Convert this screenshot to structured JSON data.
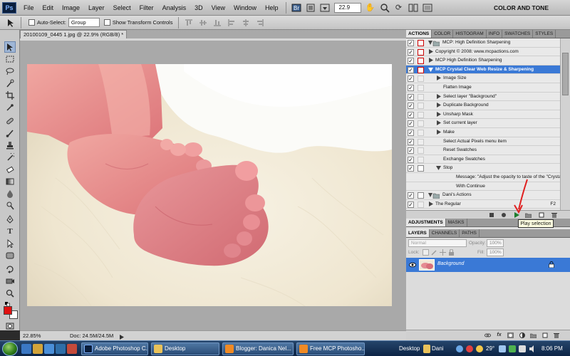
{
  "menubar": {
    "logo": "Ps",
    "items": [
      "File",
      "Edit",
      "Image",
      "Layer",
      "Select",
      "Filter",
      "Analysis",
      "3D",
      "View",
      "Window",
      "Help"
    ],
    "zoom": "22.9",
    "workspace": "COLOR AND TONE"
  },
  "options": {
    "auto_select_label": "Auto-Select:",
    "auto_select_value": "Group",
    "transform_label": "Show Transform Controls"
  },
  "document": {
    "tab_title": "20100109_0445 1.jpg @ 22.9% (RGB/8) *",
    "status_zoom": "22.85%",
    "status_doc": "Doc: 24.5M/24.5M"
  },
  "actions_panel": {
    "tabs": [
      "ACTIONS",
      "COLOR",
      "HISTOGRAM",
      "INFO",
      "SWATCHES",
      "STYLES"
    ],
    "rows": [
      {
        "label": "MCP: High Definition Sharpening",
        "type": "set",
        "checked": true,
        "dialog": "red",
        "indent": 1
      },
      {
        "label": "Copyright © 2008: www.mcpactions.com",
        "type": "action",
        "checked": true,
        "dialog": "red",
        "indent": 1
      },
      {
        "label": "MCP High Definition Sharpening",
        "type": "action",
        "checked": true,
        "dialog": "red",
        "indent": 1
      },
      {
        "label": "MCP Crystal Clear Web Resize & Sharpening",
        "type": "action-open",
        "checked": true,
        "dialog": "red",
        "indent": 1,
        "selected": true
      },
      {
        "label": "Image Size",
        "type": "step",
        "checked": true,
        "dialog": "",
        "indent": 2
      },
      {
        "label": "Flatten Image",
        "type": "step-plain",
        "checked": true,
        "dialog": "",
        "indent": 2
      },
      {
        "label": "Select layer \"Background\"",
        "type": "step",
        "checked": true,
        "dialog": "",
        "indent": 2
      },
      {
        "label": "Duplicate Background",
        "type": "step",
        "checked": true,
        "dialog": "",
        "indent": 2
      },
      {
        "label": "Unsharp Mask",
        "type": "step",
        "checked": true,
        "dialog": "",
        "indent": 2
      },
      {
        "label": "Set current layer",
        "type": "step",
        "checked": true,
        "dialog": "",
        "indent": 2
      },
      {
        "label": "Make",
        "type": "step",
        "checked": true,
        "dialog": "",
        "indent": 2
      },
      {
        "label": "Select Actual Pixels menu item",
        "type": "step-plain",
        "checked": true,
        "dialog": "",
        "indent": 2
      },
      {
        "label": "Reset Swatches",
        "type": "step-plain",
        "checked": true,
        "dialog": "",
        "indent": 2
      },
      {
        "label": "Exchange Swatches",
        "type": "step-plain",
        "checked": true,
        "dialog": "",
        "indent": 2
      },
      {
        "label": "Stop",
        "type": "step-open",
        "checked": true,
        "dialog": "box",
        "indent": 2
      },
      {
        "label": "Message: \"Adjust the opacity to taste of the \"Crystal...",
        "type": "detail",
        "checked": false,
        "dialog": "",
        "indent": 3
      },
      {
        "label": "With Continue",
        "type": "detail",
        "checked": false,
        "dialog": "",
        "indent": 3
      },
      {
        "label": "Dani's Actions",
        "type": "set",
        "checked": true,
        "dialog": "box",
        "indent": 1
      },
      {
        "label": "The Regular",
        "type": "action",
        "checked": true,
        "dialog": "",
        "indent": 1,
        "shortcut": "F2"
      }
    ],
    "tooltip": "Play selection"
  },
  "adjustments_panel": {
    "tabs": [
      "ADJUSTMENTS",
      "MASKS"
    ]
  },
  "layers_panel": {
    "tabs": [
      "LAYERS",
      "CHANNELS",
      "PATHS"
    ],
    "blend_mode": "Normal",
    "opacity_label": "Opacity:",
    "opacity_value": "100%",
    "lock_label": "Lock:",
    "fill_label": "Fill:",
    "fill_value": "100%",
    "layer_name": "Background"
  },
  "taskbar": {
    "buttons": [
      "Adobe Photoshop C...",
      "Desktop",
      "Blogger: Danica Nel...",
      "Free MCP Photosho..."
    ],
    "tray_desktop": "Desktop",
    "tray_user": "Dani",
    "temperature": "29°",
    "clock": "8:06 PM"
  },
  "colors": {
    "selection_blue": "#3a79d6",
    "foreground_swatch": "#e01010",
    "background_swatch": "#ffffff",
    "annotation_arrow": "#e02020"
  }
}
